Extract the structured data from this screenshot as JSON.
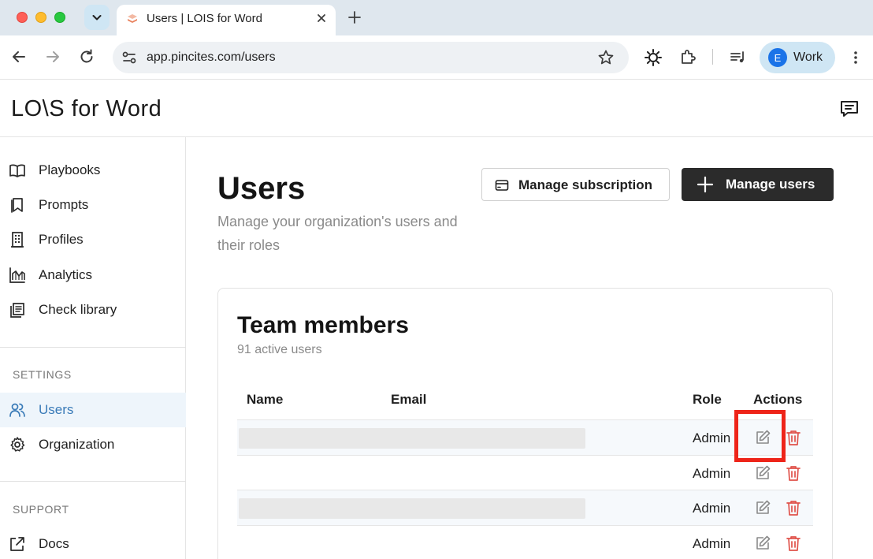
{
  "browser": {
    "tab_title": "Users | LOIS for Word",
    "url": "app.pincites.com/users",
    "profile_initial": "E",
    "profile_name": "Work"
  },
  "app": {
    "brand": "LO\\S for Word"
  },
  "sidebar": {
    "items": [
      {
        "label": "Playbooks",
        "icon": "book-icon"
      },
      {
        "label": "Prompts",
        "icon": "bookmark-icon"
      },
      {
        "label": "Profiles",
        "icon": "building-icon"
      },
      {
        "label": "Analytics",
        "icon": "chart-icon"
      },
      {
        "label": "Check library",
        "icon": "library-icon"
      }
    ],
    "settings_heading": "SETTINGS",
    "settings_items": [
      {
        "label": "Users",
        "icon": "users-icon",
        "active": true
      },
      {
        "label": "Organization",
        "icon": "gear-icon"
      }
    ],
    "support_heading": "SUPPORT",
    "support_items": [
      {
        "label": "Docs",
        "icon": "external-link-icon"
      }
    ]
  },
  "main": {
    "title": "Users",
    "subtitle": "Manage your organization's users and their roles",
    "manage_subscription": "Manage subscription",
    "manage_users": "Manage users",
    "card": {
      "title": "Team members",
      "subtitle": "91 active users",
      "columns": [
        "Name",
        "Email",
        "Role",
        "Actions"
      ],
      "rows": [
        {
          "role": "Admin",
          "redacted": true
        },
        {
          "role": "Admin",
          "redacted": false
        },
        {
          "role": "Admin",
          "redacted": true
        },
        {
          "role": "Admin",
          "redacted": false
        }
      ]
    }
  },
  "colors": {
    "accent": "#3a7bb8",
    "delete": "#e0524a",
    "highlight": "#ee2419",
    "primary_button": "#2b2b2b"
  }
}
